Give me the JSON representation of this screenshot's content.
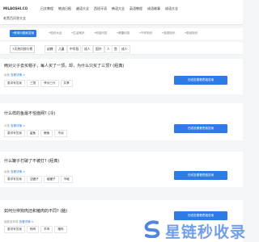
{
  "site": {
    "logo": "MILAOSHI.CO",
    "sub_title": "老黑百问答大全"
  },
  "nav": [
    "日文教程",
    "物流日报",
    "越语大全",
    "西班牙语",
    "韩语大全",
    "英语教程",
    "成语故事",
    "成语大全"
  ],
  "categories": [
    {
      "label": "•教育问题和答案",
      "active": true
    },
    {
      "label": "•知识大全",
      "active": false
    },
    {
      "label": "•生活常识",
      "active": false
    },
    {
      "label": "•科技问答",
      "active": false
    },
    {
      "label": "•健康问答",
      "active": false
    },
    {
      "label": "•汽车知识",
      "active": false
    },
    {
      "label": "•旅游知识",
      "active": false
    },
    {
      "label": "•财经知识",
      "active": false
    }
  ],
  "filters": [
    "7天热问排行榜",
    "幼教",
    "儿童",
    "中学段",
    "成人",
    "国外",
    "人",
    "鱼",
    "成人"
  ],
  "cards": [
    {
      "question": "两对父子去买帽子，每人买了一顶，却，为什么只买了三顶? (经典)",
      "meta_prefix": "经典 ",
      "meta_link": "查看详情 >",
      "tags": [
        "要求有答案",
        "三顶",
        "爷孙三代",
        "共享"
      ],
      "button": "在线答题看思路答案"
    },
    {
      "question": "什么样的鱼最不怕渔网? (冷)",
      "meta_prefix": "冷笑 ",
      "meta_link": "查看详情 >",
      "tags": [
        "要求有答案",
        "鲨鱼",
        "鲸鱼",
        "不动"
      ],
      "button": "在线答题看思路答案"
    },
    {
      "question": "什么罐子打破了不被打? (经典)",
      "meta_prefix": "经典 ",
      "meta_link": "查看详情 >",
      "tags": [
        "要求有答案",
        "空罐子",
        "破罐子",
        "不破"
      ],
      "button": "在线答题看思路答案"
    },
    {
      "question": "如何分辨狗肉还和猪肉的不同? (脑)",
      "meta_prefix": "脑筋急转弯 ",
      "meta_link": "查看详情 >",
      "tags": [
        "要求有答案",
        "狗肉",
        "羊肉",
        "猪肉"
      ],
      "button": "在线答题看思路答案"
    }
  ],
  "watermark": "星链秒收录",
  "colors": {
    "accent": "#2e7be6",
    "watermark": "#5b8fe6"
  }
}
